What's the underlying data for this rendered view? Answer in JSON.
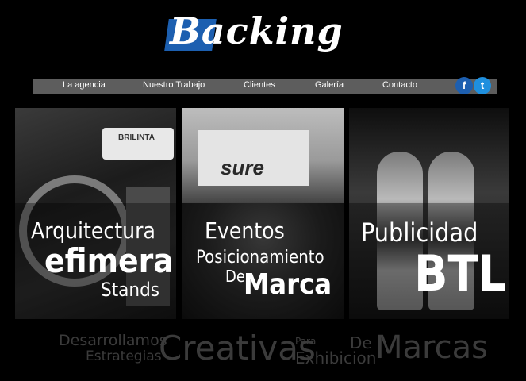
{
  "logo": {
    "text": "Backing"
  },
  "nav": {
    "items": [
      "La agencia",
      "Nuestro Trabajo",
      "Clientes",
      "Galería",
      "Contacto"
    ],
    "facebook_icon": "f",
    "twitter_icon": "t"
  },
  "panels": [
    {
      "brand": "BRILINTA",
      "line1": "Arquitectura",
      "line2": "efimera",
      "line3": "Stands"
    },
    {
      "brand": "sure",
      "line1": "Eventos",
      "line2": "Posicionamiento",
      "line3a": "De",
      "line3b": "Marca"
    },
    {
      "line1": "Publicidad",
      "line2": "BTL"
    }
  ],
  "tagline": {
    "w1": "Desarrollamos",
    "w2": "Estrategias",
    "w3": "Creativas",
    "w4": "Para",
    "w5": "Exhibicion",
    "w6": "De",
    "w7": "Marcas"
  },
  "colors": {
    "brand_blue": "#1c5fb0",
    "nav_bg": "#5d5d5d",
    "facebook": "#1d5fb0",
    "twitter": "#1f8fde",
    "tagline": "#3b3b3b"
  }
}
